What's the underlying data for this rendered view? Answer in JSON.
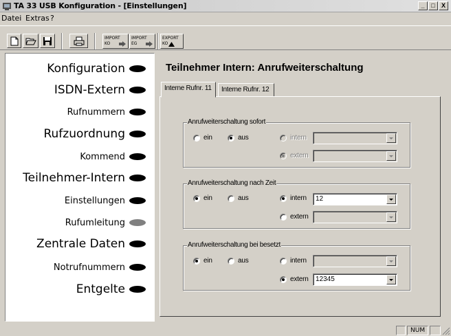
{
  "window": {
    "title": "TA 33 USB Konfiguration - [Einstellungen]",
    "controls": [
      "_",
      "□",
      "X"
    ]
  },
  "menu": [
    "Datei",
    "Extras",
    "?"
  ],
  "toolbar": {
    "icons": [
      "new-icon",
      "open-icon",
      "save-icon",
      "print-icon"
    ],
    "import_ko": [
      "IMPORT",
      "KO"
    ],
    "import_eg": [
      "IMPORT",
      "EG"
    ],
    "export_ko": [
      "EXPORT",
      "KO"
    ]
  },
  "sidebar": {
    "items": [
      {
        "label": "Konfiguration",
        "size": "big",
        "active": false
      },
      {
        "label": "ISDN-Extern",
        "size": "big",
        "active": false
      },
      {
        "label": "Rufnummern",
        "size": "small",
        "active": false
      },
      {
        "label": "Rufzuordnung",
        "size": "big",
        "active": false
      },
      {
        "label": "Kommend",
        "size": "small",
        "active": false
      },
      {
        "label": "Teilnehmer-Intern",
        "size": "big",
        "active": false
      },
      {
        "label": "Einstellungen",
        "size": "small",
        "active": false
      },
      {
        "label": "Rufumleitung",
        "size": "small",
        "active": true
      },
      {
        "label": "Zentrale Daten",
        "size": "big",
        "active": false
      },
      {
        "label": "Notrufnummern",
        "size": "small",
        "active": false
      },
      {
        "label": "Entgelte",
        "size": "big",
        "active": false
      }
    ]
  },
  "main": {
    "title": "Teilnehmer Intern: Anrufweiterschaltung",
    "tabs": [
      "Interne Rufnr. 11",
      "Interne Rufnr. 12"
    ],
    "active_tab": 0,
    "groups": [
      {
        "legend": "Anrufweiterschaltung sofort",
        "ein": "ein",
        "aus": "aus",
        "selected": "aus",
        "intern": {
          "label": "intern",
          "value": "",
          "checked": false,
          "disabled": true
        },
        "extern": {
          "label": "extern",
          "value": "",
          "checked": true,
          "disabled": true
        }
      },
      {
        "legend": "Anrufweiterschaltung nach Zeit",
        "ein": "ein",
        "aus": "aus",
        "selected": "ein",
        "intern": {
          "label": "intern",
          "value": "12",
          "checked": true,
          "disabled": false
        },
        "extern": {
          "label": "extern",
          "value": "",
          "checked": false,
          "disabled": false
        }
      },
      {
        "legend": "Anrufweiterschaltung bei besetzt",
        "ein": "ein",
        "aus": "aus",
        "selected": "ein",
        "intern": {
          "label": "intern",
          "value": "",
          "checked": false,
          "disabled": false
        },
        "extern": {
          "label": "extern",
          "value": "12345",
          "checked": true,
          "disabled": false
        }
      }
    ]
  },
  "statusbar": {
    "num": "NUM"
  }
}
